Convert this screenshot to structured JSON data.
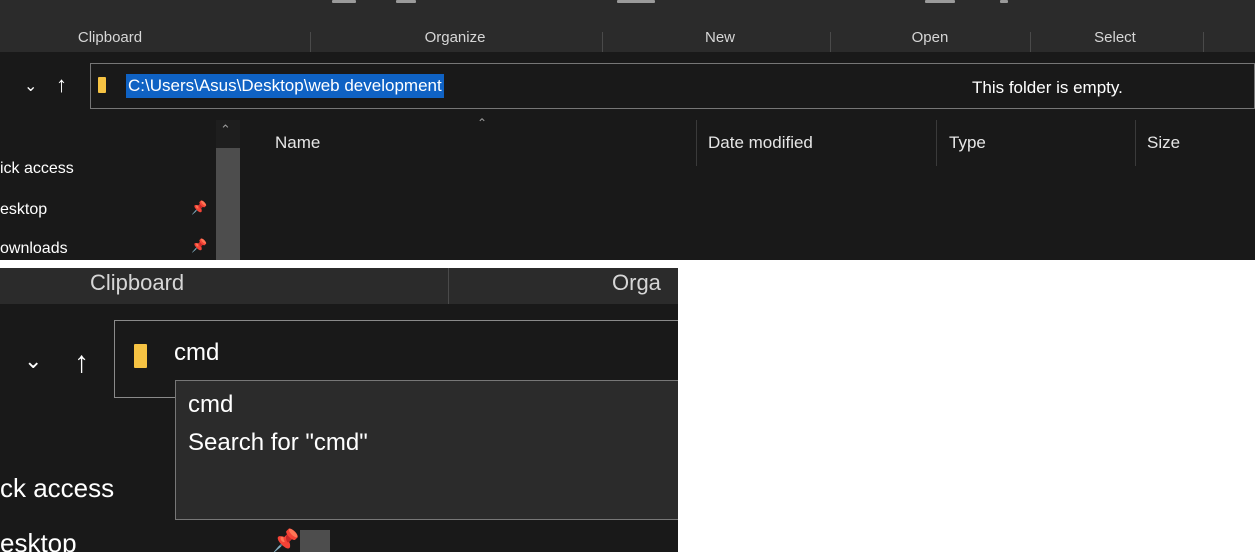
{
  "top": {
    "ribbon_groups": [
      "Clipboard",
      "Organize",
      "New",
      "Open",
      "Select"
    ],
    "address_path": "C:\\Users\\Asus\\Desktop\\web development",
    "nav_items": [
      "ick access",
      "esktop",
      "ownloads"
    ],
    "columns": [
      "Name",
      "Date modified",
      "Type",
      "Size"
    ],
    "empty_message": "This folder is empty."
  },
  "bottom": {
    "ribbon_groups": [
      "Clipboard",
      "Orga"
    ],
    "address_input": "cmd",
    "suggestions": [
      "cmd",
      "Search for \"cmd\""
    ],
    "nav_items": [
      "ck access",
      "esktop"
    ]
  },
  "colors": {
    "background": "#191919",
    "ribbon": "#2b2b2b",
    "selection": "#0f62c4",
    "folder": "#f6c343"
  },
  "icons": [
    "chevron-down-icon",
    "up-arrow-icon",
    "folder-icon",
    "pin-icon",
    "sort-up-icon"
  ]
}
